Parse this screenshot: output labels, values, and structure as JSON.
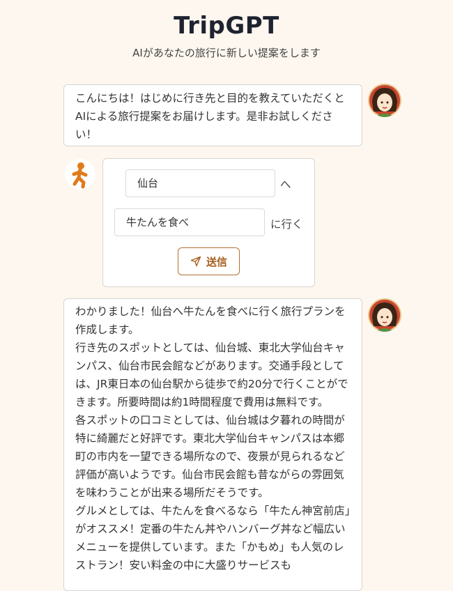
{
  "header": {
    "title": "TripGPT",
    "subtitle": "AIがあなたの旅行に新しい提案をします"
  },
  "messages": {
    "greeting": "こんにちは！はじめに行き先と目的を教えていただくとAIによる旅行提案をお届けします。是非お試しください！",
    "response": [
      "わかりました！仙台へ牛たんを食べに行く旅行プランを作成します。",
      "行き先のスポットとしては、仙台城、東北大学仙台キャンパス、仙台市民会館などがあります。交通手段としては、JR東日本の仙台駅から徒歩で約20分で行くことができます。所要時間は約1時間程度で費用は無料です。",
      "各スポットの口コミとしては、仙台城は夕暮れの時間が特に綺麗だと好評です。東北大学仙台キャンパスは本郷町の市内を一望できる場所なので、夜景が見られるなど評価が高いようです。仙台市民会館も昔ながらの雰囲気を味わうことが出来る場所だそうです。",
      "グルメとしては、牛たんを食べるなら「牛たん神宮前店」がオススメ！定番の牛たん丼やハンバーグ丼など幅広いメニューを提供しています。また「かもめ」も人気のレストラン！安い料金の中に大盛りサービスも"
    ]
  },
  "form": {
    "destination_value": "仙台",
    "destination_suffix": "へ",
    "purpose_value": "牛たんを食べ",
    "purpose_suffix": "に行く",
    "send_label": "送信"
  },
  "icons": {
    "ai_avatar": "girl-avatar-icon",
    "user_avatar": "running-person-icon",
    "send": "paper-plane-icon"
  },
  "colors": {
    "background": "#fdf7ef",
    "accent": "#b5702f",
    "user_icon": "#e07b1a"
  }
}
